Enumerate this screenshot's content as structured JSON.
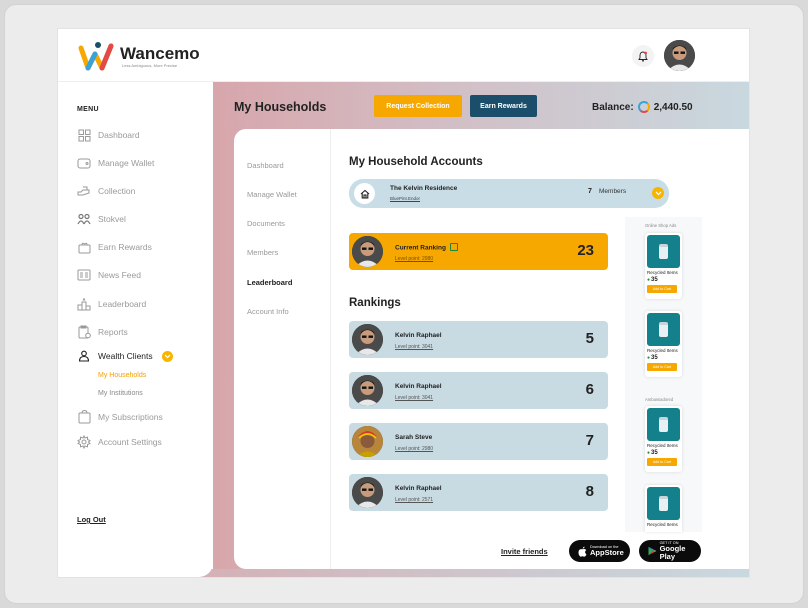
{
  "brand": {
    "name": "Wancemo",
    "tagline": "Less Ambiguous, More Precise"
  },
  "header": {
    "title": "My Households",
    "request_label": "Request Collection",
    "earn_label": "Earn Rewards",
    "balance_label": "Balance:",
    "balance_value": "2,440.50"
  },
  "sidebar": {
    "menu_title": "MENU",
    "items": [
      {
        "label": "Dashboard",
        "icon": "grid-icon"
      },
      {
        "label": "Manage Wallet",
        "icon": "wallet-icon"
      },
      {
        "label": "Collection",
        "icon": "collection-icon"
      },
      {
        "label": "Stokvel",
        "icon": "group-icon"
      },
      {
        "label": "Earn Rewards",
        "icon": "gift-icon"
      },
      {
        "label": "News Feed",
        "icon": "news-icon"
      },
      {
        "label": "Leaderboard",
        "icon": "podium-icon"
      },
      {
        "label": "Reports",
        "icon": "report-icon"
      },
      {
        "label": "Wealth Clients",
        "icon": "clients-icon"
      },
      {
        "label": "My Subscriptions",
        "icon": "subscription-icon"
      },
      {
        "label": "Account Settings",
        "icon": "gear-icon"
      }
    ],
    "sub_items": [
      "My Households",
      "My Institutions"
    ],
    "logout": "Log Out"
  },
  "subnav": [
    "Dashboard",
    "Manage Wallet",
    "Documents",
    "Members",
    "Leaderboard",
    "Account Info"
  ],
  "accounts": {
    "heading": "My Household Accounts",
    "household": {
      "name": "The Kelvin Residence",
      "code": "BluePint.Endor",
      "count": "7",
      "members_label": "Members"
    }
  },
  "current_ranking": {
    "label": "Current Ranking",
    "level": "Level point: 2980",
    "rank": "23"
  },
  "rankings_heading": "Rankings",
  "rankings": [
    {
      "name": "Kelvin Raphael",
      "level": "Level point: 3041",
      "rank": "5"
    },
    {
      "name": "Kelvin Raphael",
      "level": "Level point: 3041",
      "rank": "6"
    },
    {
      "name": "Sarah Steve",
      "level": "Level point: 2980",
      "rank": "7"
    },
    {
      "name": "Kelvin Raphael",
      "level": "Level point: 2571",
      "rank": "8"
    }
  ],
  "ads": {
    "label_top": "Online Shop Ads",
    "label_mid": "Ambassadored",
    "items": [
      {
        "title": "Recycled Items",
        "price": "35",
        "button": "Add to Cart"
      },
      {
        "title": "Recycled Items",
        "price": "35",
        "button": "Add to Cart"
      },
      {
        "title": "Recycled Items",
        "price": "35",
        "button": "Add to Cart"
      },
      {
        "title": "Recycled Items",
        "price": "",
        "button": ""
      }
    ]
  },
  "footer": {
    "invite": "Invite friends",
    "appstore_small": "Download on the",
    "appstore_big": "AppStore",
    "play_small": "GET IT ON",
    "play_big": "Google Play"
  },
  "colors": {
    "accent": "#f7a800",
    "navy": "#1b4e6b",
    "card": "#c8dbe2"
  }
}
